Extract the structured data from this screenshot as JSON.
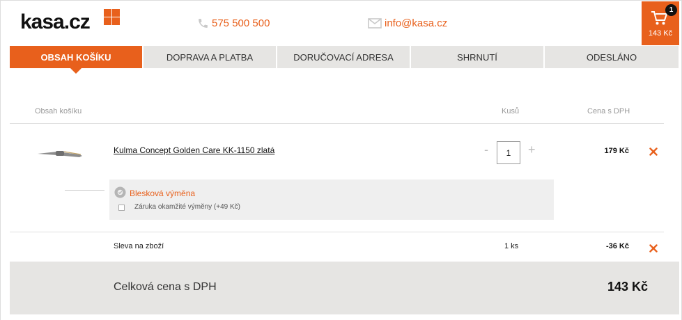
{
  "header": {
    "logo": "kasa.cz",
    "phone": "575 500 500",
    "email": "info@kasa.cz",
    "cart_count": "1",
    "cart_total": "143 Kč"
  },
  "tabs": [
    {
      "label": "Obsah košíku",
      "active": true
    },
    {
      "label": "Doprava a platba",
      "active": false
    },
    {
      "label": "Doručovací adresa",
      "active": false
    },
    {
      "label": "Shrnutí",
      "active": false
    },
    {
      "label": "Odesláno",
      "active": false
    }
  ],
  "table": {
    "col_content": "Obsah košíku",
    "col_qty": "Kusů",
    "col_price": "Cena s DPH"
  },
  "product": {
    "name": "Kulma Concept Golden Care KK-1150 zlatá",
    "quantity": "1",
    "minus": "-",
    "plus": "+",
    "price": "179 Kč"
  },
  "insurance": {
    "title": "Blesková výměna",
    "option": "Záruka okamžité výměny (+49 Kč)",
    "checked": false
  },
  "discount": {
    "label": "Sleva na zboží",
    "quantity": "1 ks",
    "price": "-36 Kč"
  },
  "total": {
    "label": "Celková cena s DPH",
    "value": "143 Kč"
  },
  "colors": {
    "accent": "#e8601c",
    "tab_bg": "#e6e5e3",
    "total_bg": "#e6e5e3"
  },
  "icons": {
    "phone": "phone-icon",
    "email": "envelope-icon",
    "cart": "cart-icon",
    "remove": "remove-x-icon",
    "insurance": "gear-badge-icon"
  }
}
